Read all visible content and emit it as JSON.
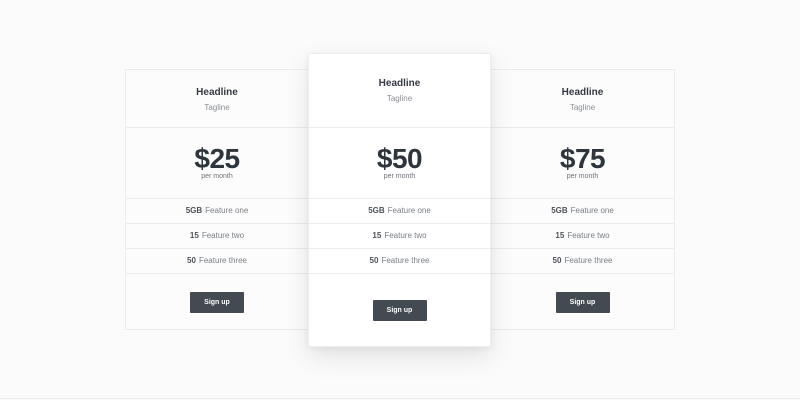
{
  "plans": [
    {
      "headline": "Headline",
      "tagline": "Tagline",
      "price": "$25",
      "period": "per month",
      "features": [
        {
          "value": "5GB",
          "label": "Feature one"
        },
        {
          "value": "15",
          "label": "Feature two"
        },
        {
          "value": "50",
          "label": "Feature three"
        }
      ],
      "button_label": "Sign up"
    },
    {
      "headline": "Headline",
      "tagline": "Tagline",
      "price": "$50",
      "period": "per month",
      "features": [
        {
          "value": "5GB",
          "label": "Feature one"
        },
        {
          "value": "15",
          "label": "Feature two"
        },
        {
          "value": "50",
          "label": "Feature three"
        }
      ],
      "button_label": "Sign up"
    },
    {
      "headline": "Headline",
      "tagline": "Tagline",
      "price": "$75",
      "period": "per month",
      "features": [
        {
          "value": "5GB",
          "label": "Feature one"
        },
        {
          "value": "15",
          "label": "Feature two"
        },
        {
          "value": "50",
          "label": "Feature three"
        }
      ],
      "button_label": "Sign up"
    }
  ],
  "colors": {
    "background": "#fbfbfb",
    "card_border": "#ececec",
    "text_dark": "#343a42",
    "text_muted": "#8a8f96",
    "button_bg": "#444a52",
    "button_text": "#ffffff"
  }
}
